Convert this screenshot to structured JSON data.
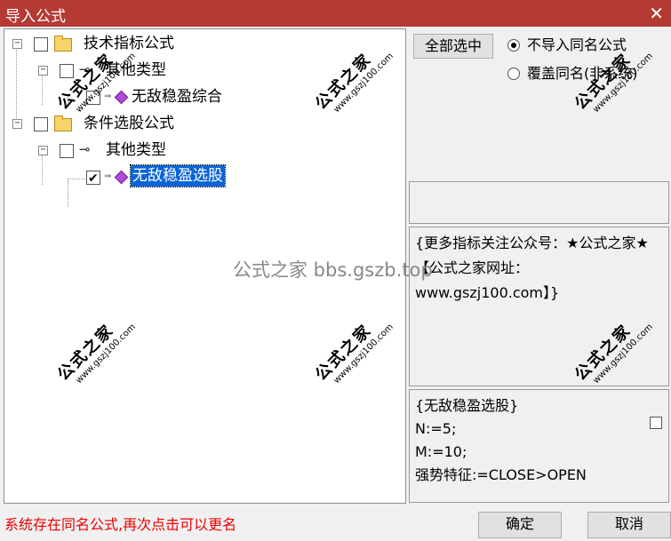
{
  "dialog": {
    "title": "导入公式",
    "close_icon": "close-icon"
  },
  "tree": {
    "nodes": [
      {
        "label": "技术指标公式",
        "icon": "folder-icon",
        "checked": false,
        "expander": "⊟"
      },
      {
        "label": "其他类型",
        "icon": "key-icon",
        "checked": false,
        "expander": "⊟"
      },
      {
        "label": "无敌稳盈综合",
        "icon": "formula-gem-icon",
        "checked": false
      },
      {
        "label": "条件选股公式",
        "icon": "folder-icon",
        "checked": false,
        "expander": "⊟"
      },
      {
        "label": "其他类型",
        "icon": "key-icon",
        "checked": false,
        "expander": "⊟"
      },
      {
        "label": "无敌稳盈选股",
        "icon": "formula-gem-icon",
        "checked": true,
        "selected": true
      }
    ]
  },
  "right": {
    "select_all_label": "全部选中",
    "radio_no_import_label": "不导入同名公式",
    "radio_overwrite_label": "覆盖同名(非系统)",
    "description": "{更多指标关注公众号：★公式之家★ 【公式之家网址：www.gszj100.com】}",
    "code_lines": [
      "{无敌稳盈选股}",
      "N:=5;",
      "M:=10;",
      "强势特征:=CLOSE>OPEN"
    ]
  },
  "status_text": "系统存在同名公式,再次点击可以更名",
  "buttons": {
    "ok_label": "确定",
    "cancel_label": "取消"
  },
  "watermark": {
    "big": "公式之家",
    "url": "www.gszj100.com",
    "center": "公式之家 bbs.gszb.top"
  },
  "colors": {
    "titlebar": "#b53a34",
    "selection": "#0a64d6",
    "status": "#e00000"
  }
}
